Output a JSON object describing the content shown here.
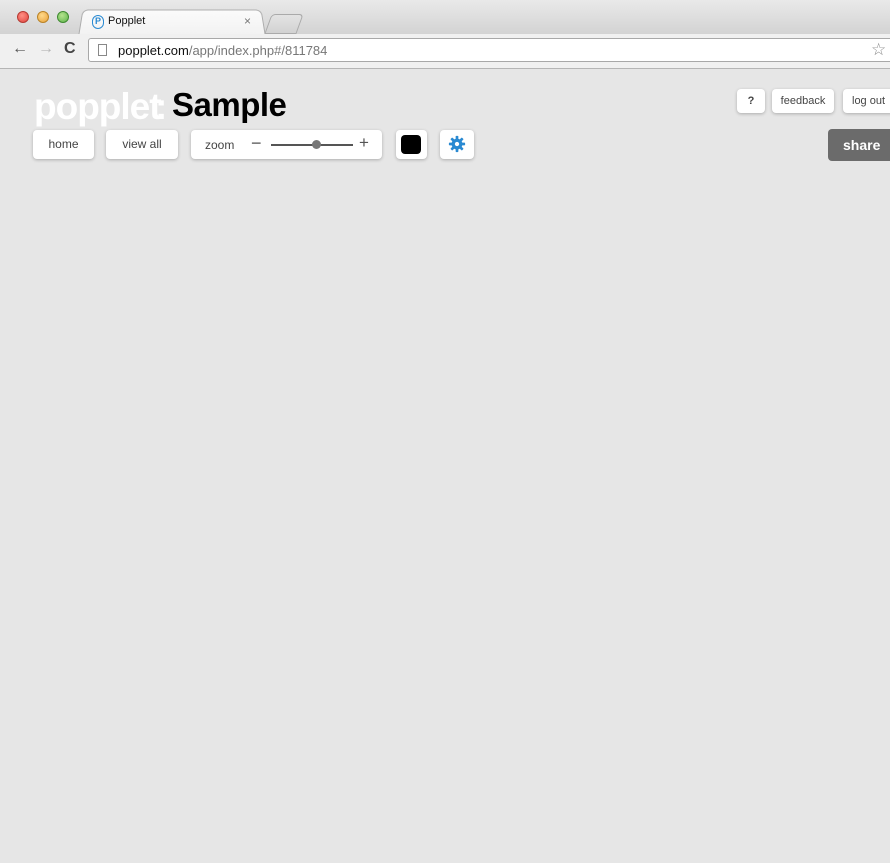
{
  "browser": {
    "tab_title": "Popplet",
    "tab_favicon_glyph": "P",
    "tab_close_glyph": "×",
    "url_domain": "popplet.com",
    "url_path": "/app/index.php#/811784",
    "icons": {
      "back": "←",
      "forward": "→",
      "reload": "C",
      "star": "☆"
    }
  },
  "app": {
    "logo_word": "popplet",
    "logo_colon": ":",
    "document_title": "Sample",
    "toolbar": {
      "home_label": "home",
      "view_all_label": "view all",
      "zoom_label": "zoom",
      "zoom_minus": "−",
      "zoom_plus": "+",
      "zoom_level": 0.55,
      "color_value": "#000000",
      "settings_glyph": "✿"
    },
    "top_right": {
      "help_label": "?",
      "feedback_label": "feedback",
      "logout_label": "log out",
      "share_label": "share"
    },
    "colors": {
      "canvas_background": "#e6e6e6",
      "accent": "#2a8ad2",
      "share_button": "#6b6b6b"
    }
  }
}
